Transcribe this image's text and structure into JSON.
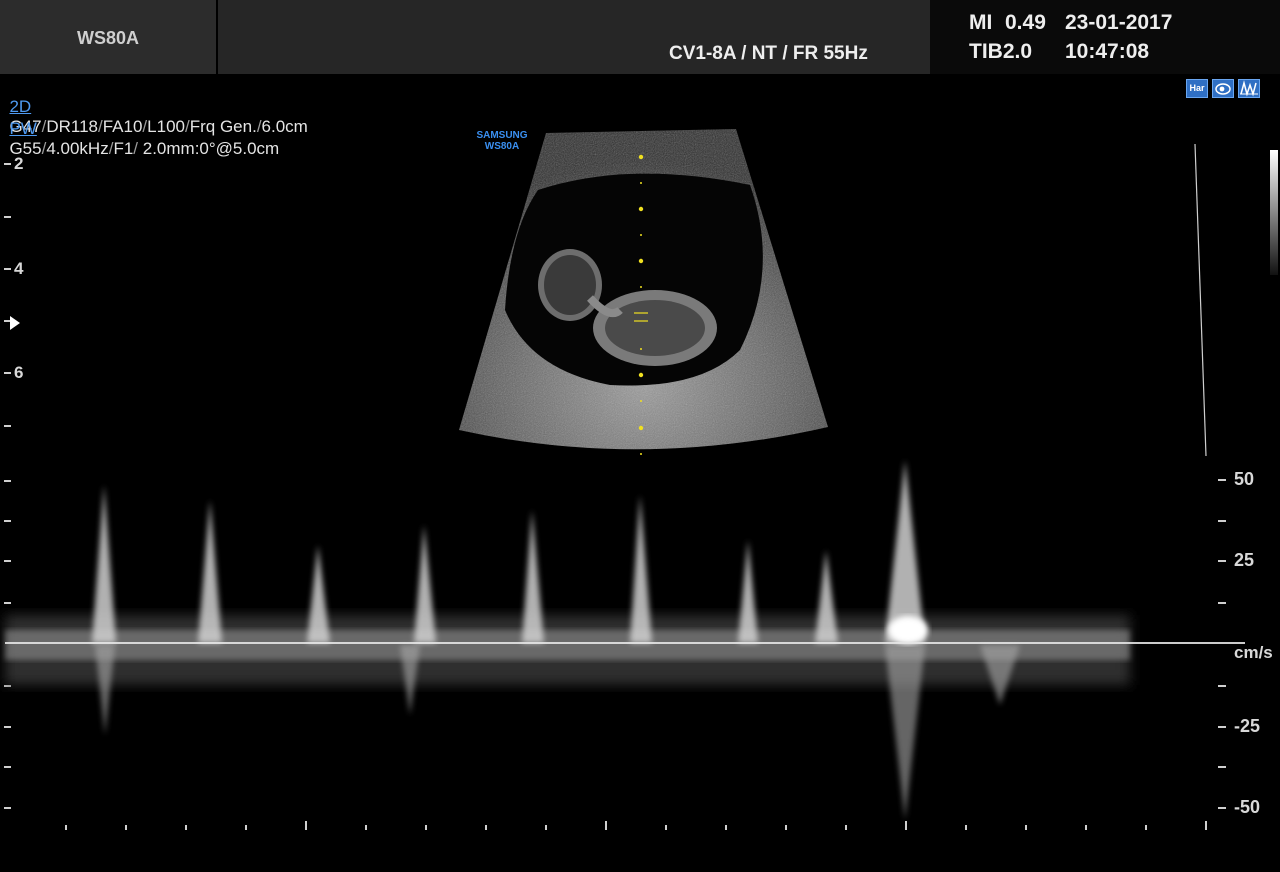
{
  "header": {
    "model": "WS80A",
    "probe_info": "CV1-8A / NT / FR 55Hz",
    "mi_label": "MI",
    "mi_value": "0.49",
    "tib_label": "TIB2.0",
    "date": "23-01-2017",
    "time": "10:47:08"
  },
  "params": {
    "line_2d": {
      "mode": "2D",
      "values": [
        "G47",
        "DR118",
        "FA10",
        "L100",
        "Frq Gen.",
        "6.0cm"
      ]
    },
    "line_pw": {
      "mode": "PW",
      "values": [
        "G55",
        "4.00kHz",
        "F1",
        " 2.0mm:0°@5.0cm"
      ]
    }
  },
  "icons": [
    {
      "name": "harmonic-icon",
      "text": "Har"
    },
    {
      "name": "fetal-preset-icon",
      "text": ""
    },
    {
      "name": "doppler-spectrum-icon",
      "text": ""
    }
  ],
  "brand": {
    "line1": "SAMSUNG",
    "line2": "WS80A"
  },
  "depth_scale": {
    "labels": [
      "2",
      "4",
      "6"
    ]
  },
  "velocity_scale": {
    "labels": [
      "50",
      "25",
      "-25",
      "-50"
    ],
    "unit": "cm/s"
  },
  "colors": {
    "mode_label": "#4f9bf2",
    "brand": "#3a8ff0",
    "icon_bg": "#2f6fc4",
    "gate_marker": "#f0e020"
  }
}
